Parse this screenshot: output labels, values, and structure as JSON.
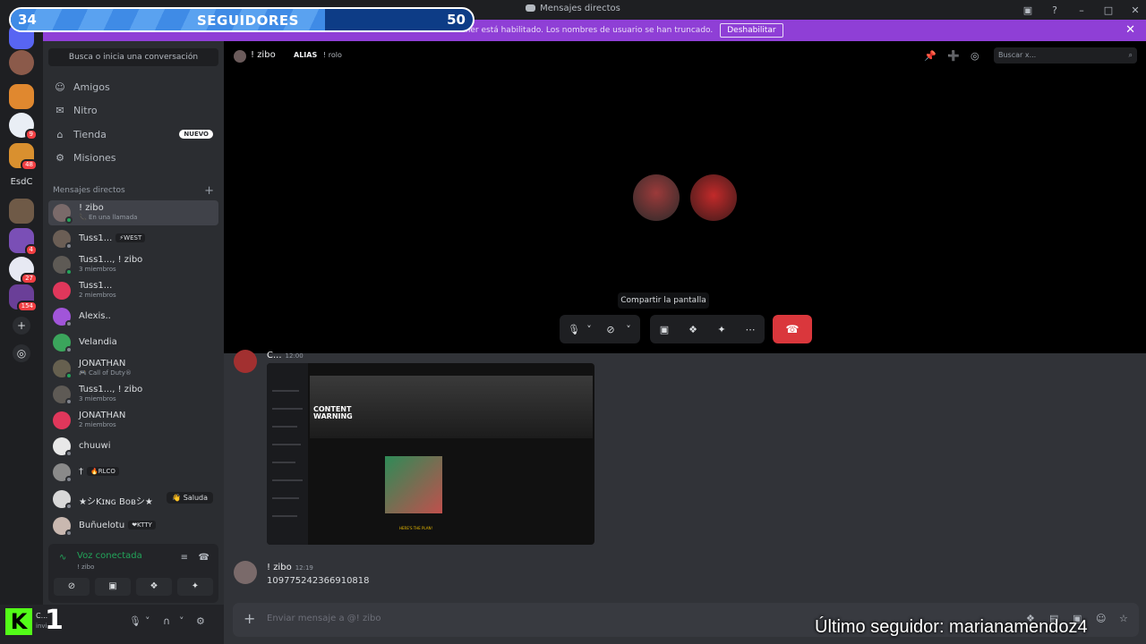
{
  "window": {
    "title": "Mensajes directos",
    "controls": [
      "▣",
      "?",
      "–",
      "□",
      "✕"
    ]
  },
  "overlay": {
    "followers_current": "34",
    "followers_label": "SEGUIDORES",
    "followers_goal": "50",
    "followers_progress_fraction": 0.68,
    "last_follower": "Último seguidor: marianamendoz4"
  },
  "banner": {
    "text": "El modo Streamer está habilitado. Los nombres de usuario se han truncado.",
    "disable_label": "Deshabilitar",
    "close_icon": "✕"
  },
  "rail": {
    "folder_label": "EsdC",
    "badges": [
      "9",
      "48",
      "4",
      "27",
      "154"
    ],
    "add_icon": "+",
    "explore_icon": "◎"
  },
  "sidebar": {
    "search_placeholder": "Busca o inicia una conversación",
    "nav": [
      {
        "icon": "friends-icon",
        "glyph": "☺",
        "label": "Amigos"
      },
      {
        "icon": "nitro-icon",
        "glyph": "✉",
        "label": "Nitro"
      },
      {
        "icon": "shop-icon",
        "glyph": "⌂",
        "label": "Tienda",
        "badge": "NUEVO"
      },
      {
        "icon": "quests-icon",
        "glyph": "⚙",
        "label": "Misiones"
      }
    ],
    "dm_header": "Mensajes directos",
    "dm_add": "+",
    "dms": [
      {
        "name": "! zibo",
        "sub": "📞 En una llamada",
        "active": true
      },
      {
        "name": "Tuss1...",
        "tag": "⚡WEST"
      },
      {
        "name": "Tuss1..., ! zibo",
        "sub": "3 miembros"
      },
      {
        "name": "Tuss1...",
        "sub": "2 miembros"
      },
      {
        "name": "Alexis.."
      },
      {
        "name": "Velandia"
      },
      {
        "name": "JONATHAN",
        "sub": "🎮 Call of Duty®"
      },
      {
        "name": "Tuss1..., ! zibo",
        "sub": "3 miembros"
      },
      {
        "name": "JONATHAN",
        "sub": "2 miembros"
      },
      {
        "name": "chuuwi"
      },
      {
        "name": "†",
        "tag": "🔥RLCO"
      },
      {
        "name": "★シKɪɴɢ Bᴏʙシ★",
        "wave": "👋 Saluda"
      },
      {
        "name": "Buñuelotu",
        "tag": "❤KTTY"
      }
    ],
    "voice": {
      "status": "Voz conectada",
      "channel": "! zibo",
      "signal_icon": "∿",
      "noise_icon": "≡",
      "disconnect_icon": "☎",
      "buttons": [
        "⊘",
        "▣",
        "❖",
        "✦"
      ]
    },
    "user": {
      "logo": "K",
      "number": "1",
      "name": "C...",
      "sub": "invi...",
      "mic": "🎙",
      "headset": "∩",
      "settings": "⚙",
      "arrow": "˅"
    }
  },
  "header": {
    "name": "! zibo",
    "alias_label": "ALIAS",
    "alias_value": "! rolo",
    "search_placeholder": "Buscar x...",
    "search_icon": "⌕",
    "icons": [
      "📌",
      "➕",
      "◎"
    ]
  },
  "call": {
    "tooltip": "Compartir la pantalla",
    "controls": {
      "mic": "🎙",
      "camera": "⊘",
      "chevron": "˅",
      "share": "▣",
      "activities": "❖",
      "soundboard": "✦",
      "more": "⋯",
      "hangup": "☎"
    }
  },
  "messages": [
    {
      "author": "C...",
      "time": "12:00",
      "image": {
        "title": "CONTENT\nWARNING",
        "subtitle": "HERE'S THE PLAN!"
      }
    },
    {
      "author": "! zibo",
      "time": "12:19",
      "text": "1097752423669108​18"
    }
  ],
  "composer": {
    "placeholder": "Enviar mensaje a @! zibo",
    "plus": "+",
    "icons": [
      "❖",
      "▤",
      "▣",
      "☺",
      "☆"
    ]
  },
  "colors": {
    "accent": "#5865f2",
    "banner": "#8f3fd6",
    "online": "#23a55a",
    "danger": "#da373c",
    "kick": "#53fc18"
  }
}
